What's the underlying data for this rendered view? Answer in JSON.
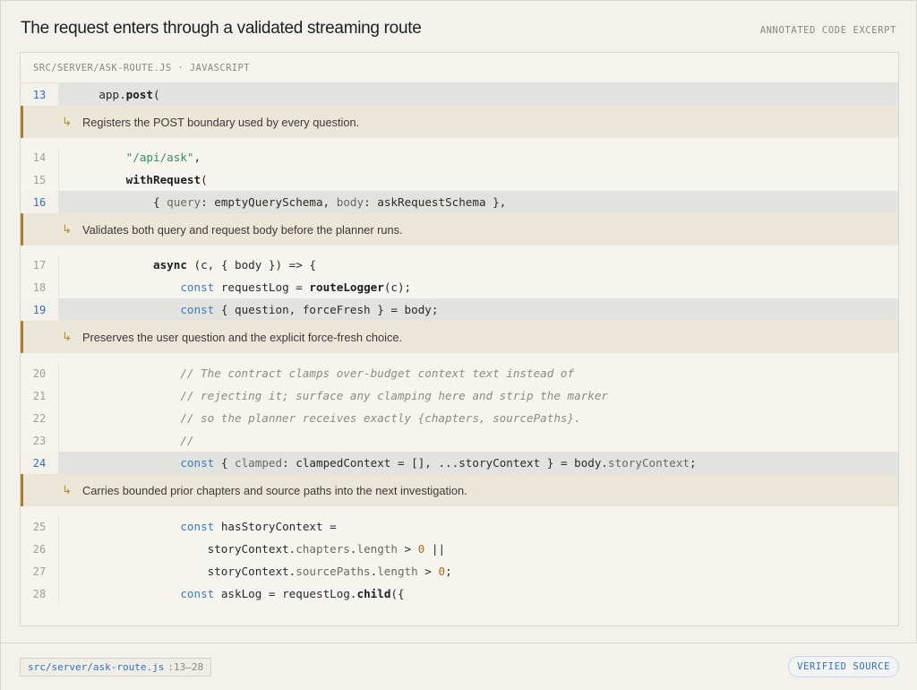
{
  "header": {
    "title": "The request enters through a validated streaming route",
    "kind": "ANNOTATED CODE EXCERPT"
  },
  "panel": {
    "file_label": "SRC/SERVER/ASK-ROUTE.JS · JAVASCRIPT"
  },
  "lines": {
    "l13": "13",
    "l14": "14",
    "l15": "15",
    "l16": "16",
    "l17": "17",
    "l18": "18",
    "l19": "19",
    "l20": "20",
    "l21": "21",
    "l22": "22",
    "l23": "23",
    "l24": "24",
    "l25": "25",
    "l26": "26",
    "l27": "27",
    "l28": "28"
  },
  "annotations": {
    "a1": "Registers the POST boundary used by every question.",
    "a2": "Validates both query and request body before the planner runs.",
    "a3": "Preserves the user question and the explicit force-fresh choice.",
    "a4": "Carries bounded prior chapters and source paths into the next investigation."
  },
  "icons": {
    "annotation_arrow": "return-arrow-icon",
    "arrow_glyph": "↳"
  },
  "footer": {
    "path": "src/server/ask-route.js",
    "range": ":13–28",
    "badge": "VERIFIED SOURCE"
  },
  "colors": {
    "accent": "#3b6ea8",
    "annotation_bar": "#a87f2c",
    "annotation_bg": "#ece6d8",
    "highlight_bg": "#e2e2df"
  }
}
